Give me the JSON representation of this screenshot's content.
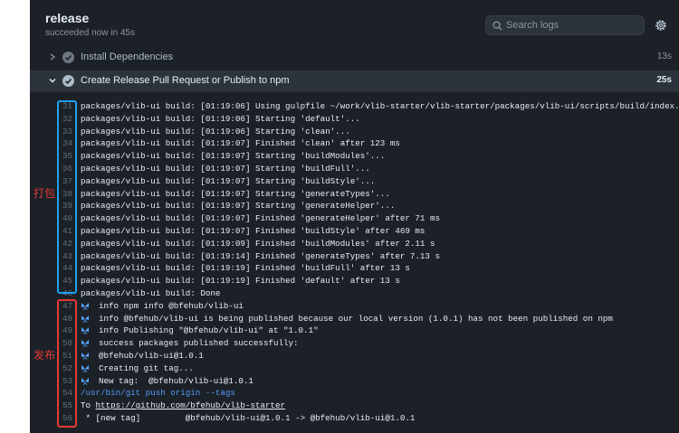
{
  "header": {
    "title": "release",
    "subtitle": "succeeded now in 45s",
    "search_placeholder": "Search logs",
    "settings_icon": "gear-icon"
  },
  "steps": [
    {
      "name": "Install Dependencies",
      "duration": "13s",
      "expanded": false
    },
    {
      "name": "Create Release Pull Request or Publish to npm",
      "duration": "25s",
      "expanded": true
    }
  ],
  "annotations": {
    "pack": "打包",
    "publish": "发布"
  },
  "log": [
    {
      "n": "31",
      "text": "packages/vlib-ui build: [01:19:06] Using gulpfile ~/work/vlib-starter/vlib-starter/packages/vlib-ui/scripts/build/index.ts"
    },
    {
      "n": "32",
      "text": "packages/vlib-ui build: [01:19:06] Starting 'default'..."
    },
    {
      "n": "33",
      "text": "packages/vlib-ui build: [01:19:06] Starting 'clean'..."
    },
    {
      "n": "34",
      "text": "packages/vlib-ui build: [01:19:07] Finished 'clean' after 123 ms"
    },
    {
      "n": "35",
      "text": "packages/vlib-ui build: [01:19:07] Starting 'buildModules'..."
    },
    {
      "n": "36",
      "text": "packages/vlib-ui build: [01:19:07] Starting 'buildFull'..."
    },
    {
      "n": "37",
      "text": "packages/vlib-ui build: [01:19:07] Starting 'buildStyle'..."
    },
    {
      "n": "38",
      "text": "packages/vlib-ui build: [01:19:07] Starting 'generateTypes'..."
    },
    {
      "n": "39",
      "text": "packages/vlib-ui build: [01:19:07] Starting 'generateHelper'..."
    },
    {
      "n": "40",
      "text": "packages/vlib-ui build: [01:19:07] Finished 'generateHelper' after 71 ms"
    },
    {
      "n": "41",
      "text": "packages/vlib-ui build: [01:19:07] Finished 'buildStyle' after 469 ms"
    },
    {
      "n": "42",
      "text": "packages/vlib-ui build: [01:19:09] Finished 'buildModules' after 2.11 s"
    },
    {
      "n": "43",
      "text": "packages/vlib-ui build: [01:19:14] Finished 'generateTypes' after 7.13 s"
    },
    {
      "n": "44",
      "text": "packages/vlib-ui build: [01:19:19] Finished 'buildFull' after 13 s"
    },
    {
      "n": "45",
      "text": "packages/vlib-ui build: [01:19:19] Finished 'default' after 13 s"
    },
    {
      "n": "46",
      "text": "packages/vlib-ui build: Done"
    },
    {
      "n": "47",
      "icon": true,
      "text": "info npm info @bfehub/vlib-ui"
    },
    {
      "n": "48",
      "icon": true,
      "text": "info @bfehub/vlib-ui is being published because our local version (1.0.1) has not been published on npm"
    },
    {
      "n": "49",
      "icon": true,
      "text": "info Publishing \"@bfehub/vlib-ui\" at \"1.0.1\""
    },
    {
      "n": "50",
      "icon": true,
      "text": "success packages published successfully:"
    },
    {
      "n": "51",
      "icon": true,
      "text": "@bfehub/vlib-ui@1.0.1"
    },
    {
      "n": "52",
      "icon": true,
      "text": "Creating git tag..."
    },
    {
      "n": "53",
      "icon": true,
      "text": "New tag:  @bfehub/vlib-ui@1.0.1"
    },
    {
      "n": "54",
      "kind": "cmd",
      "text": "/usr/bin/git push origin --tags"
    },
    {
      "n": "55",
      "kind": "url",
      "text": "To ",
      "link": "https://github.com/bfehub/vlib-starter"
    },
    {
      "n": "56",
      "text": " * [new tag]         @bfehub/vlib-ui@1.0.1 -> @bfehub/vlib-ui@1.0.1"
    }
  ],
  "colors": {
    "panel_bg": "#1c2128",
    "accent_blue": "#1da1f2",
    "accent_red": "#e53935",
    "changeset_icon": "#58a6ff"
  }
}
